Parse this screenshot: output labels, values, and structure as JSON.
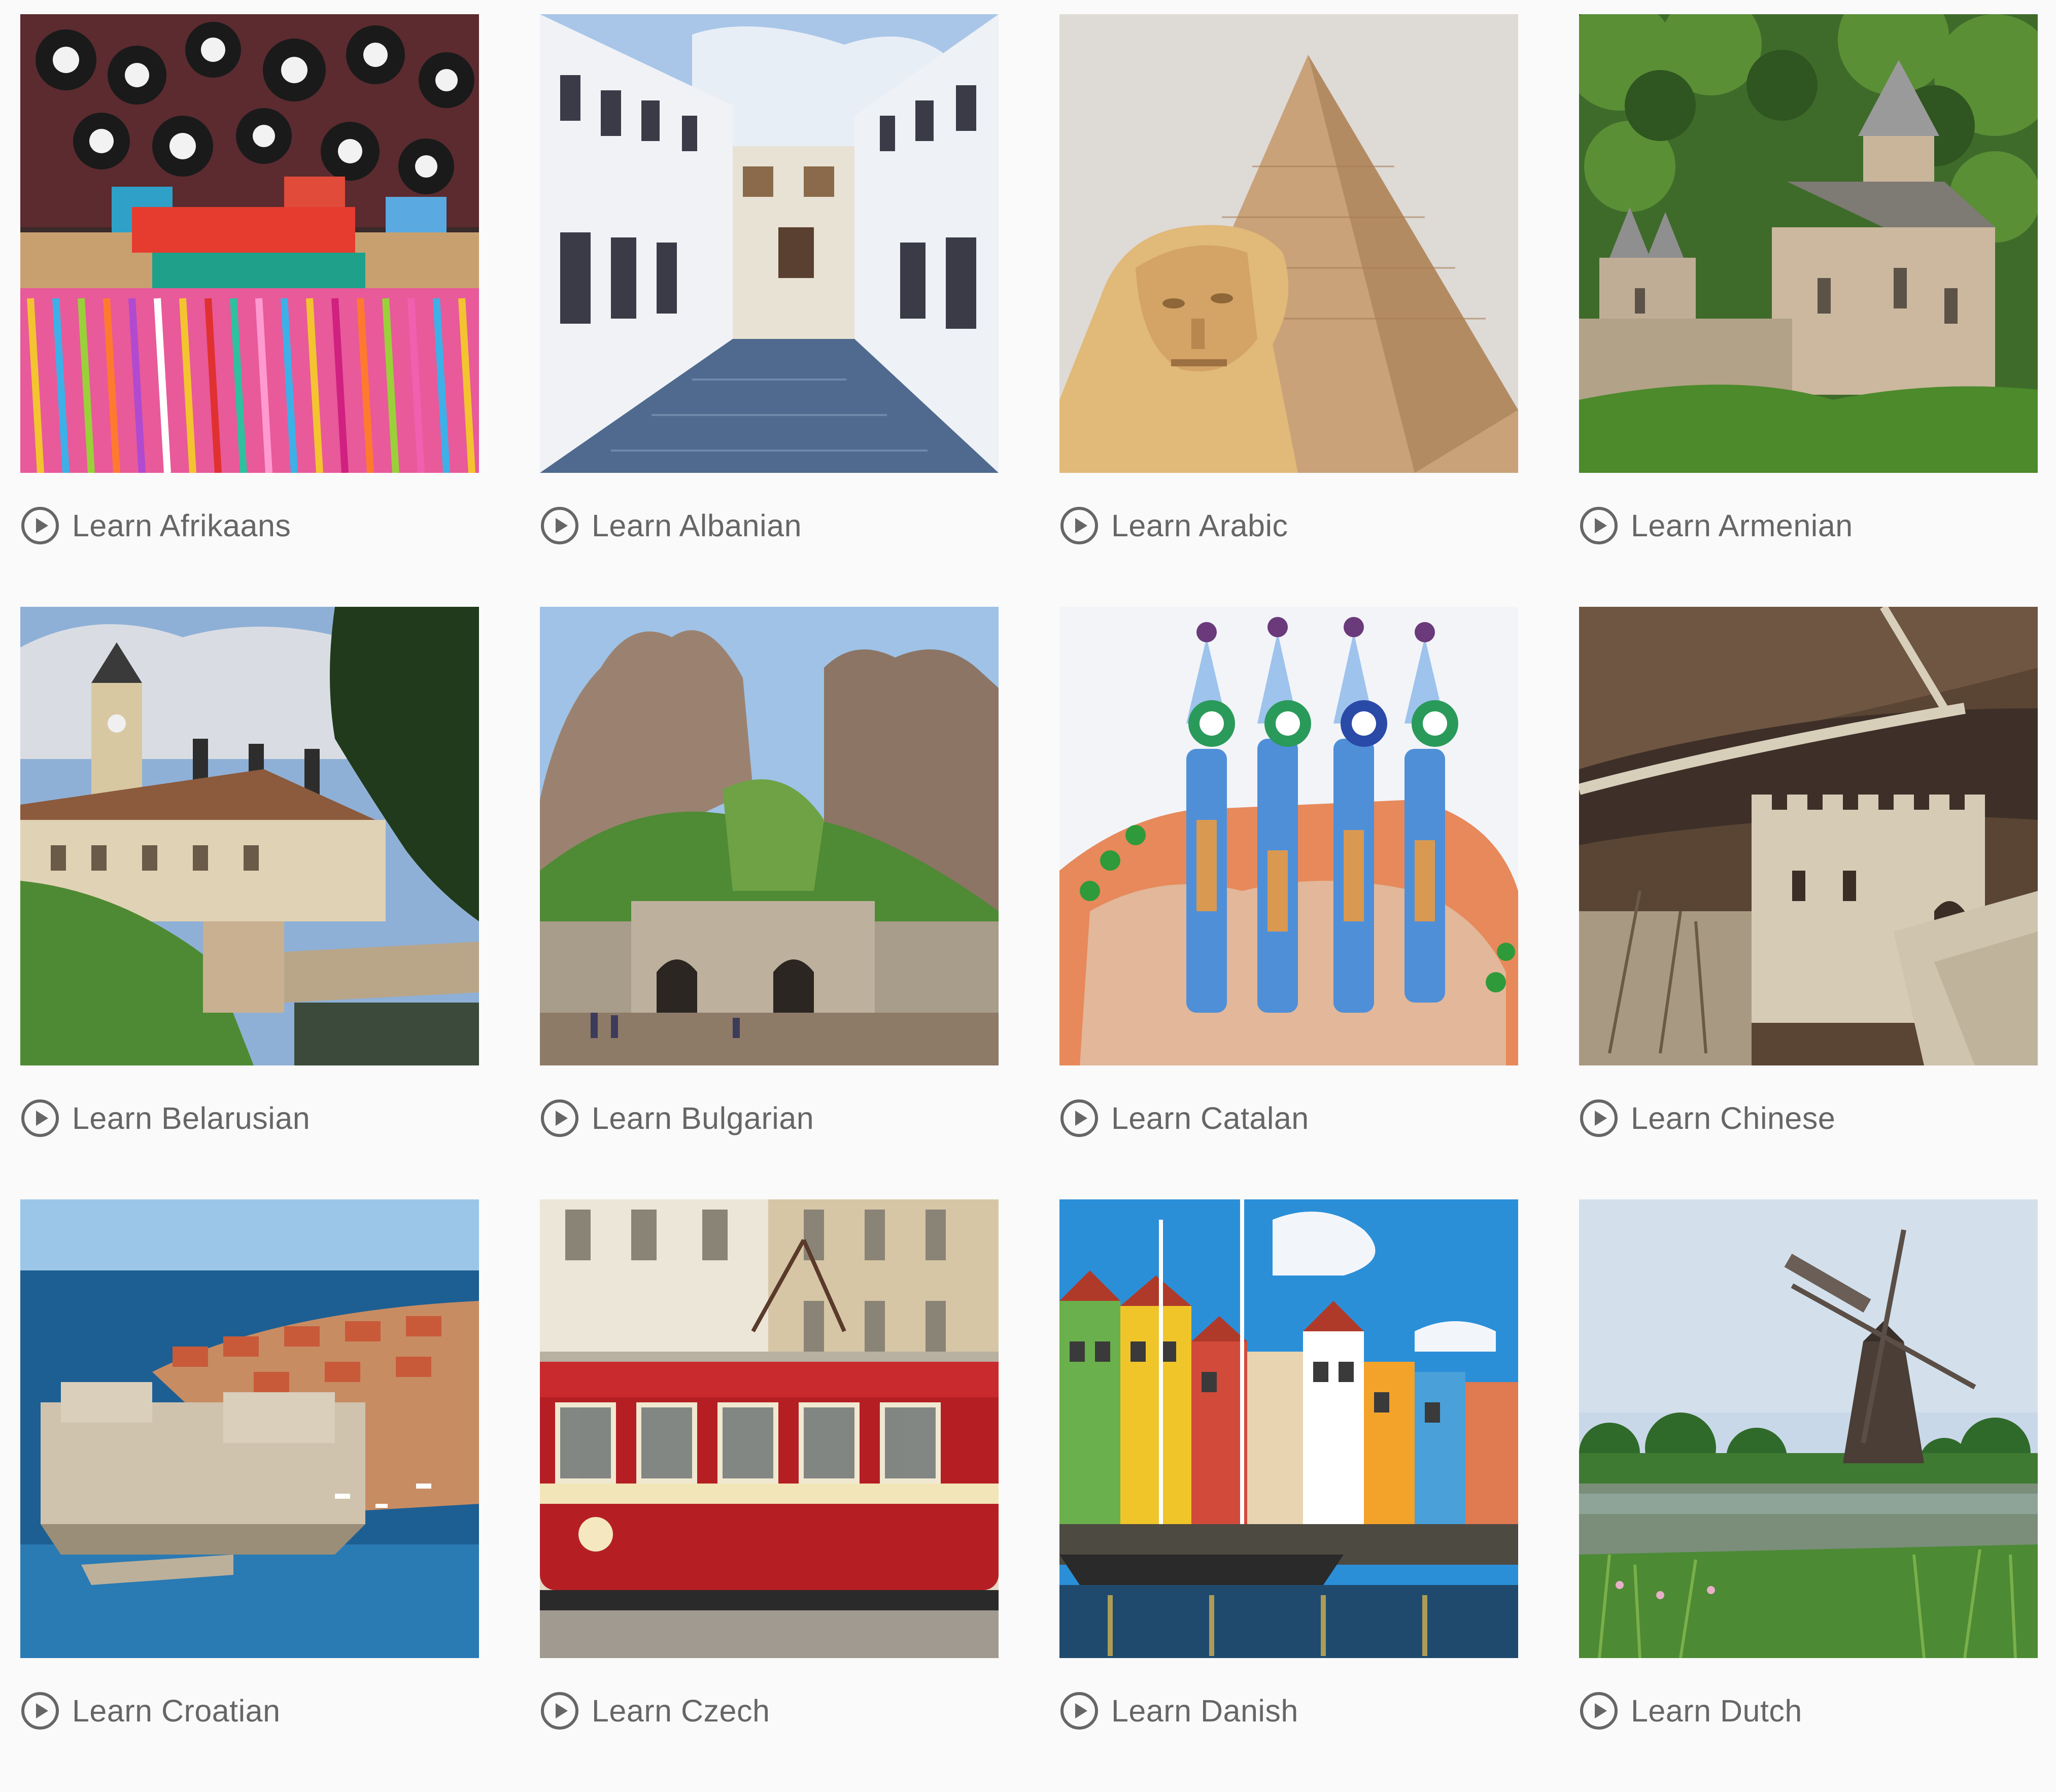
{
  "courses": [
    {
      "label": "Learn Afrikaans",
      "icon": "play-circle-icon",
      "scene": "colorful market stall with beaded souvenirs"
    },
    {
      "label": "Learn Albanian",
      "icon": "play-circle-icon",
      "scene": "cobblestone street between white buildings"
    },
    {
      "label": "Learn Arabic",
      "icon": "play-circle-icon",
      "scene": "sphinx in front of pyramid"
    },
    {
      "label": "Learn Armenian",
      "icon": "play-circle-icon",
      "scene": "stone monastery in green forest"
    },
    {
      "label": "Learn Belarusian",
      "icon": "play-circle-icon",
      "scene": "castle with towers and green lawn"
    },
    {
      "label": "Learn Bulgarian",
      "icon": "play-circle-icon",
      "scene": "rock formations above fortress gate"
    },
    {
      "label": "Learn Catalan",
      "icon": "play-circle-icon",
      "scene": "mosaic chimneys with colorful tiles"
    },
    {
      "label": "Learn Chinese",
      "icon": "play-circle-icon",
      "scene": "great wall watchtower on hills"
    },
    {
      "label": "Learn Croatian",
      "icon": "play-circle-icon",
      "scene": "walled coastal old town by blue sea"
    },
    {
      "label": "Learn Czech",
      "icon": "play-circle-icon",
      "scene": "red vintage tram in city street"
    },
    {
      "label": "Learn Danish",
      "icon": "play-circle-icon",
      "scene": "colorful harbor houses with boats"
    },
    {
      "label": "Learn Dutch",
      "icon": "play-circle-icon",
      "scene": "windmill beside a canal"
    }
  ],
  "colors": {
    "background": "#fafafa",
    "caption_text": "#666666",
    "icon": "#666666"
  }
}
